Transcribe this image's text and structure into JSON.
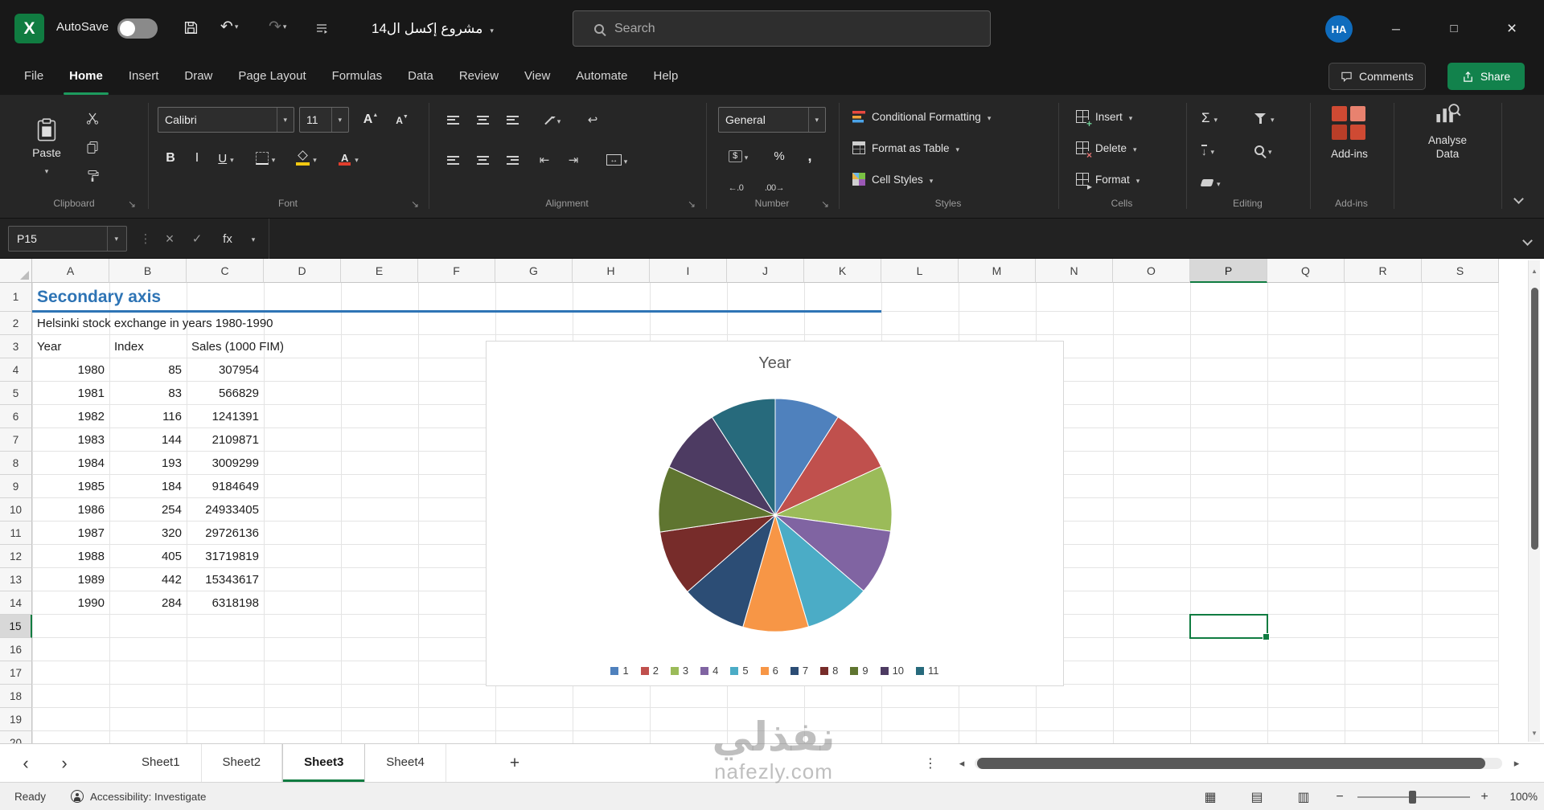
{
  "titlebar": {
    "autosave_label": "AutoSave",
    "doc_title": "مشروع إكسل ال14",
    "search_placeholder": "Search",
    "avatar_initials": "HA"
  },
  "ribbon_tabs": {
    "tabs": [
      "File",
      "Home",
      "Insert",
      "Draw",
      "Page Layout",
      "Formulas",
      "Data",
      "Review",
      "View",
      "Automate",
      "Help"
    ],
    "active_tab": "Home",
    "comments_label": "Comments",
    "share_label": "Share"
  },
  "ribbon": {
    "paste_label": "Paste",
    "font_name": "Calibri",
    "font_size": "11",
    "number_format": "General",
    "styles_buttons": [
      "Conditional Formatting",
      "Format as Table",
      "Cell Styles"
    ],
    "cells_buttons": [
      "Insert",
      "Delete",
      "Format"
    ],
    "addins_button": "Add-ins",
    "analyse_button": "Analyse Data",
    "group_labels": [
      "Clipboard",
      "Font",
      "Alignment",
      "Number",
      "Styles",
      "Cells",
      "Editing",
      "Add-ins"
    ],
    "glyphs": {
      "bold": "B",
      "italic": "I",
      "underline": "U",
      "autosum": "Σ",
      "percent": "%",
      "comma": ",",
      "accounting": "$",
      "font_color": "A"
    }
  },
  "formula_bar": {
    "name_box": "P15",
    "fx": "fx",
    "value": ""
  },
  "grid": {
    "columns": [
      "A",
      "B",
      "C",
      "D",
      "E",
      "F",
      "G",
      "H",
      "I",
      "J",
      "K",
      "L",
      "M",
      "N",
      "O",
      "P",
      "Q",
      "R",
      "S"
    ],
    "rows": [
      "1",
      "2",
      "3",
      "4",
      "5",
      "6",
      "7",
      "8",
      "9",
      "10",
      "11",
      "12",
      "13",
      "14",
      "15",
      "16",
      "17",
      "18",
      "19",
      "20"
    ],
    "selected_column": "P",
    "selected_row": "15",
    "selected_cell": "P15",
    "cells": {
      "a1": "Secondary axis",
      "a2": "Helsinki stock exchange in years 1980-1990",
      "headers": [
        "Year",
        "Index",
        "Sales (1000 FIM)"
      ],
      "data": [
        [
          1980,
          85,
          307954
        ],
        [
          1981,
          83,
          566829
        ],
        [
          1982,
          116,
          1241391
        ],
        [
          1983,
          144,
          2109871
        ],
        [
          1984,
          193,
          3009299
        ],
        [
          1985,
          184,
          9184649
        ],
        [
          1986,
          254,
          24933405
        ],
        [
          1987,
          320,
          29726136
        ],
        [
          1988,
          405,
          31719819
        ],
        [
          1989,
          442,
          15343617
        ],
        [
          1990,
          284,
          6318198
        ]
      ]
    }
  },
  "chart_data": {
    "type": "pie",
    "title": "Year",
    "labels": [
      "1",
      "2",
      "3",
      "4",
      "5",
      "6",
      "7",
      "8",
      "9",
      "10",
      "11"
    ],
    "values": [
      1980,
      1981,
      1982,
      1983,
      1984,
      1985,
      1986,
      1987,
      1988,
      1989,
      1990
    ],
    "colors": [
      "#4F81BD",
      "#C0504D",
      "#9BBB59",
      "#8064A2",
      "#4BACC6",
      "#F79646",
      "#2C4D75",
      "#772C2A",
      "#5F7530",
      "#4D3B62",
      "#276A7C"
    ],
    "legend_position": "bottom",
    "start_angle_deg": 0,
    "note": "11 near-equal slices; values are the Year column 1980-1990"
  },
  "sheet_tabs": {
    "tabs": [
      "Sheet1",
      "Sheet2",
      "Sheet3",
      "Sheet4"
    ],
    "active_tab": "Sheet3"
  },
  "status_bar": {
    "mode": "Ready",
    "accessibility": "Accessibility: Investigate",
    "zoom": "100%"
  },
  "watermark": {
    "line1": "نفذلي",
    "line2": "nafezly.com"
  },
  "colors": {
    "accent_green": "#107C41",
    "heading_blue": "#2E74B5",
    "titlebar": "#181818",
    "ribbon": "#262626"
  }
}
